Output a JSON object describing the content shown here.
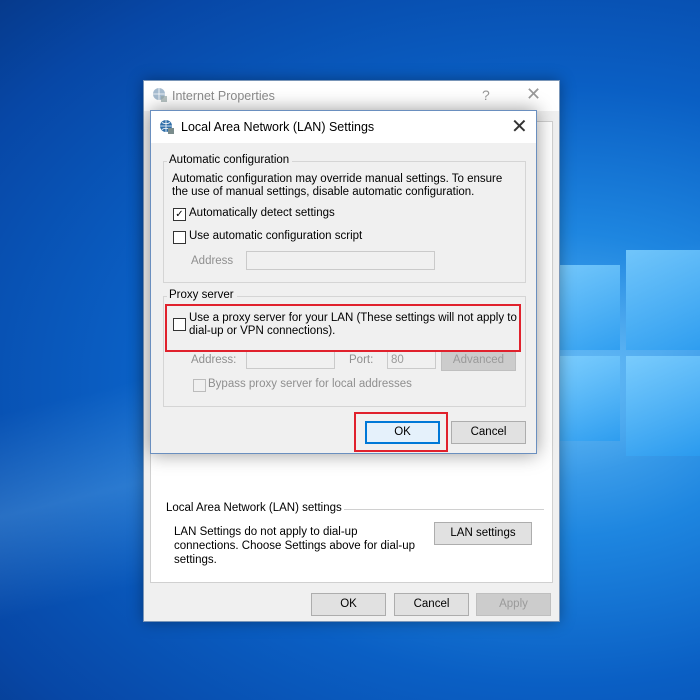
{
  "background_window": {
    "title": "Internet Properties",
    "help_glyph": "?",
    "close_glyph": "✕",
    "lan_group": {
      "title": "Local Area Network (LAN) settings",
      "description": "LAN Settings do not apply to dial-up connections. Choose Settings above for dial-up settings.",
      "button": "LAN settings"
    },
    "buttons": {
      "ok": "OK",
      "cancel": "Cancel",
      "apply": "Apply"
    }
  },
  "dialog": {
    "title": "Local Area Network (LAN) Settings",
    "close_glyph": "✕",
    "auto_config": {
      "title": "Automatic configuration",
      "description": "Automatic configuration may override manual settings.  To ensure the use of manual settings, disable automatic configuration.",
      "detect_label": "Automatically detect settings",
      "detect_checked": true,
      "script_label": "Use automatic configuration script",
      "script_checked": false,
      "address_label": "Address",
      "address_value": ""
    },
    "proxy": {
      "title": "Proxy server",
      "use_proxy_label": "Use a proxy server for your LAN (These settings will not apply to dial-up or VPN connections).",
      "use_proxy_checked": false,
      "address_label": "Address:",
      "address_value": "",
      "port_label": "Port:",
      "port_value": "80",
      "advanced_label": "Advanced",
      "bypass_label": "Bypass proxy server for local addresses",
      "bypass_checked": false
    },
    "buttons": {
      "ok": "OK",
      "cancel": "Cancel"
    }
  },
  "colors": {
    "highlight_red": "#e0212c",
    "desktop_blue": "#0a5fc4",
    "focus_blue": "#0078d7"
  },
  "icons": {
    "window_icon": "globe-settings-icon",
    "check_mark": "✓"
  }
}
